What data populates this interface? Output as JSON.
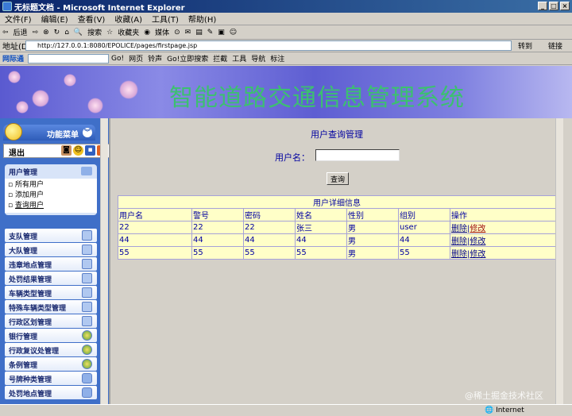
{
  "window": {
    "title": "无标题文档 - Microsoft Internet Explorer",
    "buttons": [
      "_",
      "□",
      "×"
    ]
  },
  "menu": [
    "文件(F)",
    "编辑(E)",
    "查看(V)",
    "收藏(A)",
    "工具(T)",
    "帮助(H)"
  ],
  "toolbar": {
    "back": "后退",
    "search": "搜索",
    "favorites": "收藏夹",
    "media": "媒体"
  },
  "address": {
    "label": "地址(D)",
    "url": "http://127.0.0.1:8080/EPOLICE/pages/firstpage.jsp",
    "go": "转到",
    "links": "链接"
  },
  "linkbar": {
    "item0": "网际通",
    "go": "Go!",
    "web": "网页",
    "ring": "铃声",
    "go_now": "Go!立即搜索",
    "blocker": "拦截",
    "tools": "工具",
    "nav": "导航",
    "bookmark": "标注"
  },
  "banner": {
    "title": "智能道路交通信息管理系统"
  },
  "sidebar": {
    "panel_title": "功能菜单",
    "exit_label": "退出",
    "user_group": {
      "title": "用户管理",
      "items": [
        "所有用户",
        "添加用户",
        "查询用户"
      ]
    },
    "nav_items": [
      "支队管理",
      "大队管理",
      "违章地点管理",
      "处罚结果管理",
      "车辆类型管理",
      "特殊车辆类型管理",
      "行政区划管理",
      "银行管理",
      "行政复议处管理",
      "条例管理",
      "号牌种类管理",
      "处罚地点管理"
    ]
  },
  "main": {
    "page_title": "用户查询管理",
    "username_label": "用户名：",
    "username_value": "",
    "query_button": "查询",
    "table_caption": "用户详细信息",
    "columns": [
      "用户名",
      "警号",
      "密码",
      "姓名",
      "性别",
      "组别",
      "操作"
    ],
    "delete_label": "删除",
    "edit_label": "修改",
    "rows": [
      [
        "22",
        "22",
        "22",
        "张三",
        "男",
        "user"
      ],
      [
        "44",
        "44",
        "44",
        "44",
        "男",
        "44"
      ],
      [
        "55",
        "55",
        "55",
        "55",
        "男",
        "55"
      ]
    ]
  },
  "status": {
    "zone": "Internet"
  },
  "watermark": "@稀土掘金技术社区",
  "colors": {
    "title_green": "#3cc070",
    "text_blue": "#0000a0",
    "cell_bg": "#ffffc8",
    "sidebar_blue": "#3f6fc8"
  }
}
